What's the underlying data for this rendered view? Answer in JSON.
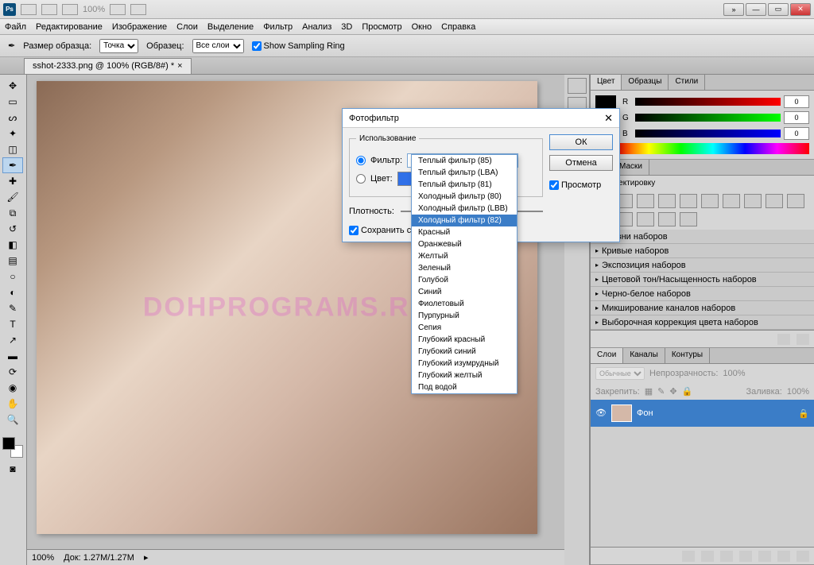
{
  "titlebar": {
    "zoom": "100%",
    "ps_label": "Ps"
  },
  "menu": [
    "Файл",
    "Редактирование",
    "Изображение",
    "Слои",
    "Выделение",
    "Фильтр",
    "Анализ",
    "3D",
    "Просмотр",
    "Окно",
    "Справка"
  ],
  "options": {
    "sample_label": "Размер образца:",
    "sample_value": "Точка",
    "sample_from_label": "Образец:",
    "sample_from_value": "Все слои",
    "show_ring": "Show Sampling Ring"
  },
  "doc": {
    "tab": "sshot-2333.png @ 100% (RGB/8#) *",
    "close": "×",
    "status_zoom": "100%",
    "status_doc": "Док: 1.27M/1.27M",
    "watermark": "DOHPROGRAMS.RU"
  },
  "color_panel": {
    "tabs": [
      "Цвет",
      "Образцы",
      "Стили"
    ],
    "r_label": "R",
    "g_label": "G",
    "b_label": "B",
    "r": "0",
    "g": "0",
    "b": "0"
  },
  "adj_panel": {
    "tab1": "ия",
    "tab2": "Маски",
    "header": "ь корректировку",
    "presets": [
      "Уровни наборов",
      "Кривые наборов",
      "Экспозиция наборов",
      "Цветовой тон/Насыщенность наборов",
      "Черно-белое наборов",
      "Микширование каналов наборов",
      "Выборочная коррекция цвета наборов"
    ]
  },
  "layers_panel": {
    "tabs": [
      "Слои",
      "Каналы",
      "Контуры"
    ],
    "mode": "Обычные",
    "opacity_label": "Непрозрачность:",
    "opacity": "100%",
    "lock_label": "Закрепить:",
    "fill_label": "Заливка:",
    "fill": "100%",
    "layer_name": "Фон"
  },
  "dialog": {
    "title": "Фотофильтр",
    "legend": "Использование",
    "filter_label": "Фильтр:",
    "filter_value": "Холодный фильтр (80)",
    "color_label": "Цвет:",
    "ok": "ОК",
    "cancel": "Отмена",
    "preview": "Просмотр",
    "density_label": "Плотность:",
    "preserve": "Сохранить с",
    "options": [
      "Теплый фильтр (85)",
      "Теплый фильтр (LBA)",
      "Теплый фильтр (81)",
      "Холодный фильтр (80)",
      "Холодный фильтр (LBB)",
      "Холодный фильтр (82)",
      "Красный",
      "Оранжевый",
      "Желтый",
      "Зеленый",
      "Голубой",
      "Синий",
      "Фиолетовый",
      "Пурпурный",
      "Сепия",
      "Глубокий красный",
      "Глубокий синий",
      "Глубокий изумрудный",
      "Глубокий желтый",
      "Под водой"
    ],
    "selected_index": 5
  }
}
